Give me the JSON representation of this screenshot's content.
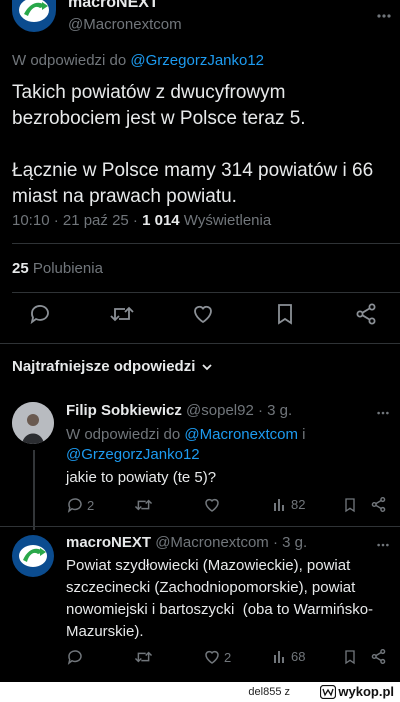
{
  "tweet": {
    "author_name": "macroNEXT",
    "author_handle": "@Macronextcom",
    "reply_prefix": "W odpowiedzi do",
    "reply_target": "@GrzegorzJanko12",
    "text": "Takich powiatów z dwucyfrowym bezrobociem jest w Polsce teraz 5.\n\nŁącznie w Polsce mamy 314 powiatów i 66 miast na prawach powiatu.",
    "time": "10:10 · 21 paź 25 · ",
    "views_count": "1 014",
    "views_label": " Wyświetlenia",
    "likes_count": "25",
    "likes_label": " Polubienia"
  },
  "sort_label": "Najtrafniejsze odpowiedzi",
  "replies": [
    {
      "name": "Filip Sobkiewicz",
      "handle": " @sopel92 · 3 g.",
      "reply_prefix": "W odpowiedzi do ",
      "reply_target1": "@Macronextcom",
      "reply_mid": " i",
      "reply_target2": "@GrzegorzJanko12",
      "text": "jakie to powiaty (te 5)?",
      "replies_count": "2",
      "views_count": "82"
    },
    {
      "name": "macroNEXT",
      "handle": " @Macronextcom · 3 g.",
      "text": "Powiat szydłowiecki (Mazowieckie), powiat szczecinecki (Zachodniopomorskie), powiat nowomiejski i bartoszycki  (oba to Warmińsko-Mazurskie).",
      "likes_count": "2",
      "views_count": "68"
    }
  ],
  "wykop": {
    "user": "del855 z",
    "brand": "wykop.pl"
  },
  "colors": {
    "background": "#000000",
    "text": "#e7e9ea",
    "muted": "#71767b",
    "link": "#1d9bf0",
    "divider": "#2f3336"
  }
}
